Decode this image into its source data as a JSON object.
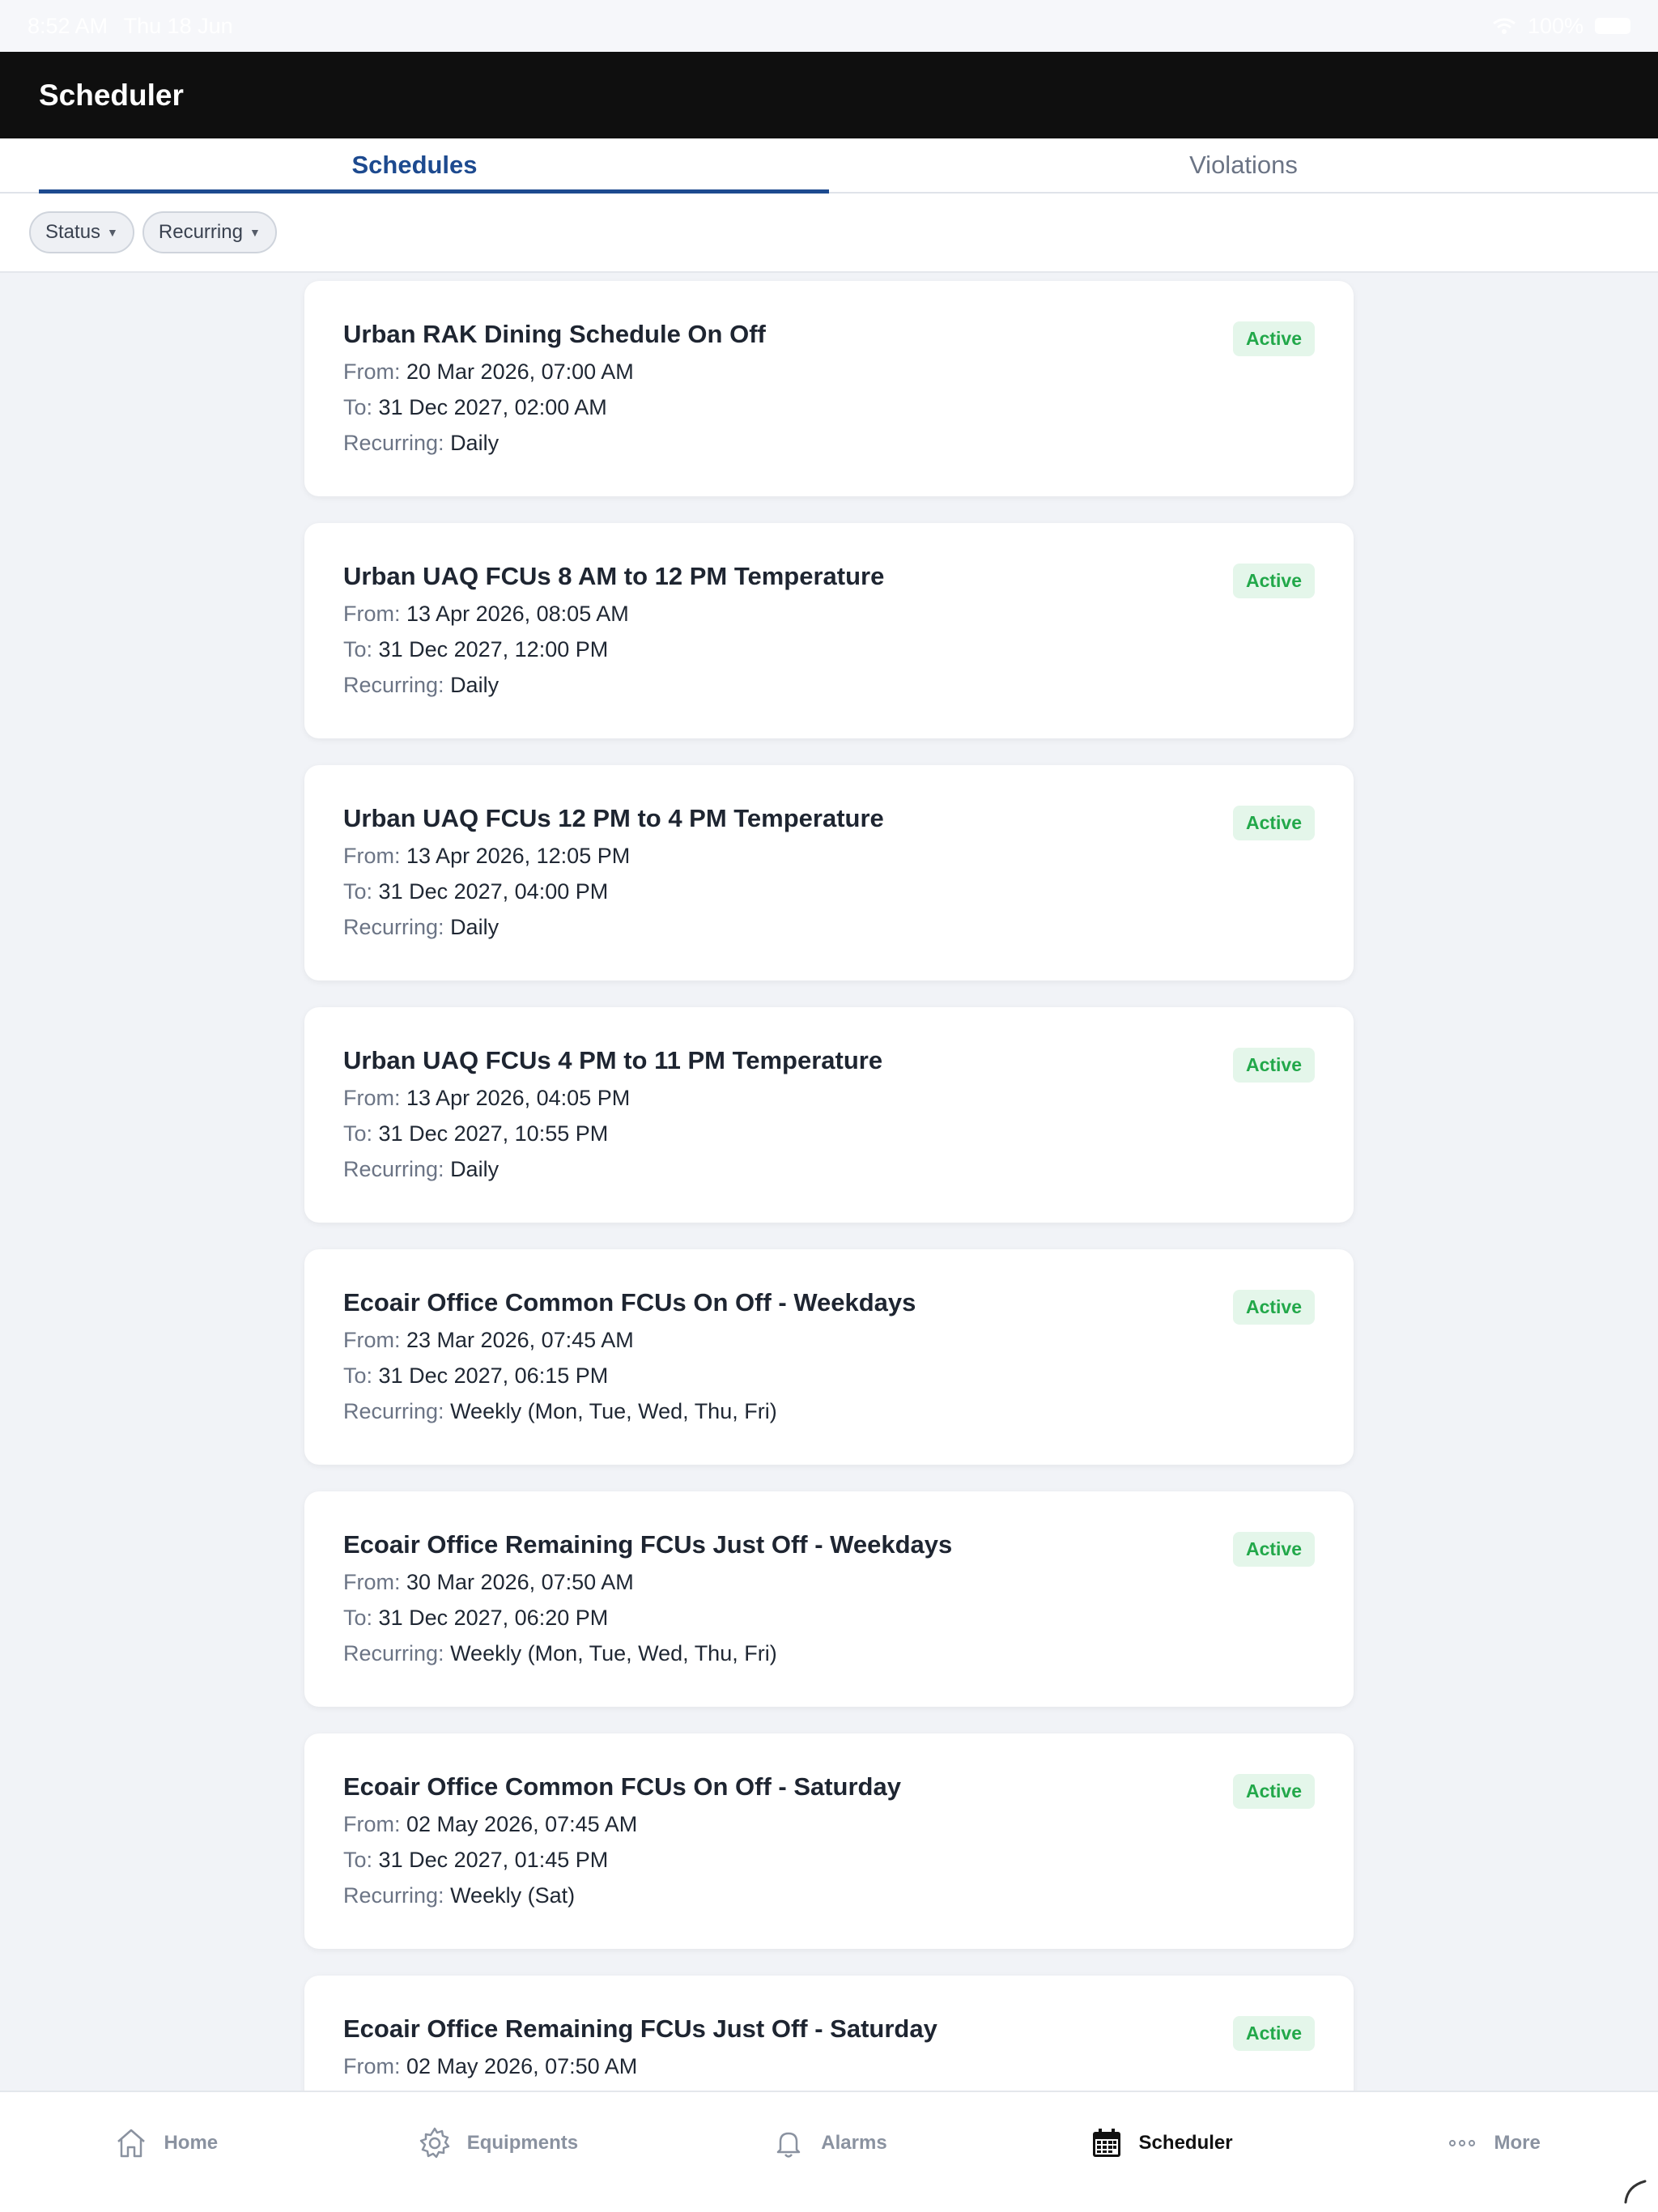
{
  "status_bar": {
    "time": "8:52 AM",
    "date": "Thu 18 Jun",
    "battery": "100%"
  },
  "app_bar": {
    "title": "Scheduler"
  },
  "tabs": [
    {
      "label": "Schedules",
      "active": true
    },
    {
      "label": "Violations",
      "active": false
    }
  ],
  "filters": [
    {
      "label": "Status"
    },
    {
      "label": "Recurring"
    }
  ],
  "labels": {
    "from": "From:",
    "to": "To:",
    "recurring": "Recurring:"
  },
  "schedules": [
    {
      "title": "Urban RAK Dining Schedule On Off",
      "status": "Active",
      "from": "20 Mar 2026, 07:00 AM",
      "to": "31 Dec 2027, 02:00 AM",
      "recurring": "Daily"
    },
    {
      "title": "Urban UAQ FCUs 8 AM to 12 PM Temperature",
      "status": "Active",
      "from": "13 Apr 2026, 08:05 AM",
      "to": "31 Dec 2027, 12:00 PM",
      "recurring": "Daily"
    },
    {
      "title": "Urban UAQ FCUs 12 PM to 4 PM Temperature",
      "status": "Active",
      "from": "13 Apr 2026, 12:05 PM",
      "to": "31 Dec 2027, 04:00 PM",
      "recurring": "Daily"
    },
    {
      "title": "Urban UAQ FCUs 4 PM to 11 PM Temperature",
      "status": "Active",
      "from": "13 Apr 2026, 04:05 PM",
      "to": "31 Dec 2027, 10:55 PM",
      "recurring": "Daily"
    },
    {
      "title": "Ecoair Office Common FCUs On Off - Weekdays",
      "status": "Active",
      "from": "23 Mar 2026, 07:45 AM",
      "to": "31 Dec 2027, 06:15 PM",
      "recurring": "Weekly (Mon, Tue, Wed, Thu, Fri)"
    },
    {
      "title": "Ecoair Office Remaining FCUs Just Off - Weekdays",
      "status": "Active",
      "from": "30 Mar 2026, 07:50 AM",
      "to": "31 Dec 2027, 06:20 PM",
      "recurring": "Weekly (Mon, Tue, Wed, Thu, Fri)"
    },
    {
      "title": "Ecoair Office Common FCUs On Off - Saturday",
      "status": "Active",
      "from": "02 May 2026, 07:45 AM",
      "to": "31 Dec 2027, 01:45 PM",
      "recurring": "Weekly (Sat)"
    },
    {
      "title": "Ecoair Office Remaining FCUs Just Off - Saturday",
      "status": "Active",
      "from": "02 May 2026, 07:50 AM",
      "to": "",
      "recurring": ""
    }
  ],
  "bottom_nav": [
    {
      "label": "Home",
      "icon": "home-icon",
      "active": false
    },
    {
      "label": "Equipments",
      "icon": "gear-icon",
      "active": false
    },
    {
      "label": "Alarms",
      "icon": "bell-icon",
      "active": false
    },
    {
      "label": "Scheduler",
      "icon": "calendar-icon",
      "active": true
    },
    {
      "label": "More",
      "icon": "more-dots-icon",
      "active": false
    }
  ],
  "colors": {
    "accent": "#1d4a8f",
    "app_bar": "#0f0f0f",
    "active_badge_text": "#22a84a",
    "active_badge_bg": "#e4f6ea"
  }
}
